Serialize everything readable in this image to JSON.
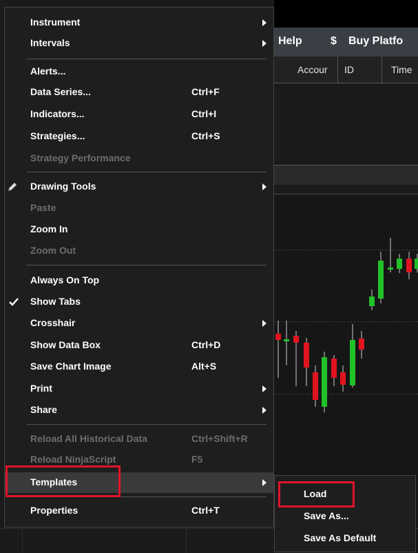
{
  "menubar": {
    "help": "Help",
    "buy": "Buy Platfo",
    "dollar": "$"
  },
  "table_headers": [
    "Accour",
    "ID",
    "Time"
  ],
  "context_menu": {
    "instrument": "Instrument",
    "intervals": "Intervals",
    "alerts": "Alerts...",
    "data_series": {
      "label": "Data Series...",
      "shortcut": "Ctrl+F"
    },
    "indicators": {
      "label": "Indicators...",
      "shortcut": "Ctrl+I"
    },
    "strategies": {
      "label": "Strategies...",
      "shortcut": "Ctrl+S"
    },
    "strategy_performance": "Strategy Performance",
    "drawing_tools": "Drawing Tools",
    "paste": "Paste",
    "zoom_in": "Zoom In",
    "zoom_out": "Zoom Out",
    "always_on_top": "Always On Top",
    "show_tabs": "Show Tabs",
    "crosshair": "Crosshair",
    "show_data_box": {
      "label": "Show Data Box",
      "shortcut": "Ctrl+D"
    },
    "save_chart_image": {
      "label": "Save Chart Image",
      "shortcut": "Alt+S"
    },
    "print": "Print",
    "share": "Share",
    "reload_all_historical": {
      "label": "Reload All Historical Data",
      "shortcut": "Ctrl+Shift+R"
    },
    "reload_ninjascript": {
      "label": "Reload NinjaScript",
      "shortcut": "F5"
    },
    "templates": "Templates",
    "properties": {
      "label": "Properties",
      "shortcut": "Ctrl+T"
    }
  },
  "submenu": {
    "load": "Load",
    "save_as": "Save As...",
    "save_as_default": "Save As Default"
  },
  "colors": {
    "menu_bg": "#1e1e1e",
    "highlight_box": "#e0142a",
    "candle_up": "#22c12a",
    "candle_down": "#e0141e"
  },
  "icons": {
    "drawing_tools": "pencil-icon",
    "show_tabs": "check-icon",
    "submenu_arrow": "chevron-right-icon"
  }
}
